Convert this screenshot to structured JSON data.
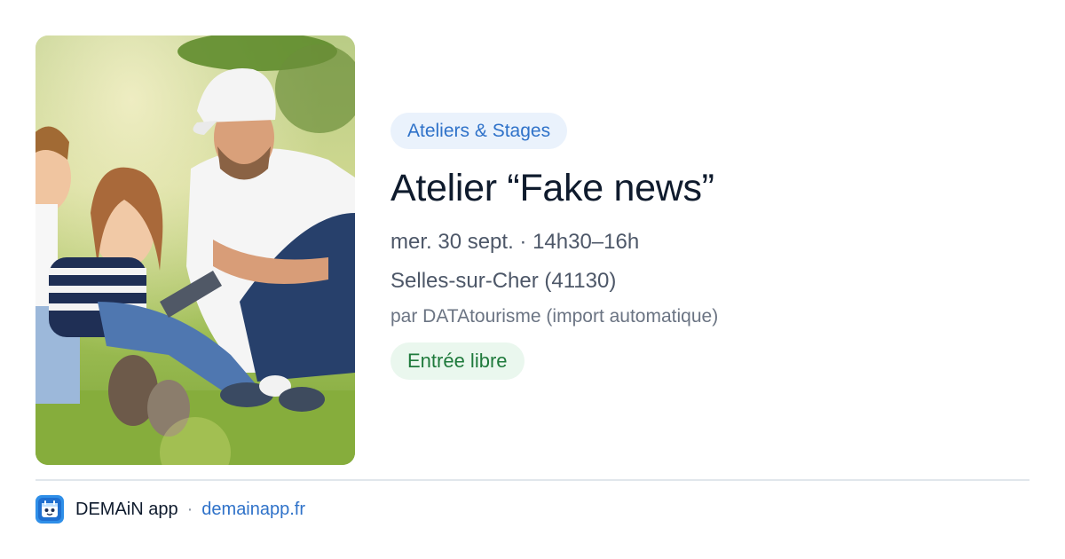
{
  "event": {
    "category": "Ateliers & Stages",
    "title": "Atelier “Fake news”",
    "datetime": "mer. 30 sept. · 14h30–16h",
    "location": "Selles-sur-Cher (41130)",
    "source": "par DATAtourisme (import automatique)",
    "price": "Entrée libre"
  },
  "footer": {
    "app_name": "DEMAiN app",
    "separator": "·",
    "url": "demainapp.fr",
    "logo_icon": "demain-app-logo-icon"
  },
  "colors": {
    "accent_blue": "#2f72c9",
    "category_bg": "#eaf2fc",
    "price_green": "#1f7a3c",
    "price_bg": "#eaf7ee",
    "divider": "#e1e7ec"
  }
}
